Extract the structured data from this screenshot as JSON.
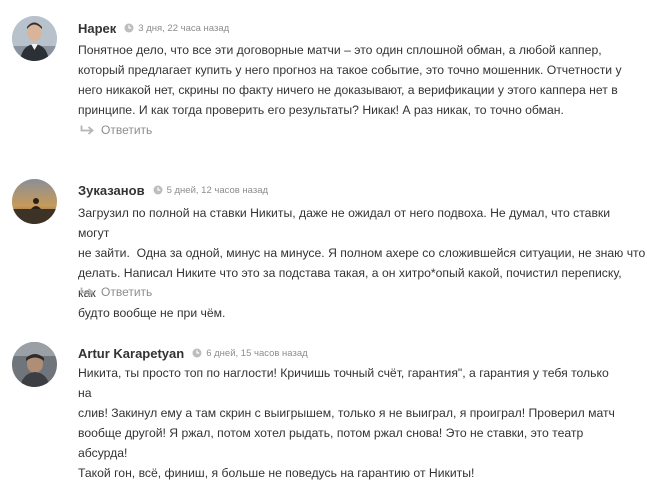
{
  "comments": [
    {
      "author": "Нарек",
      "date": "3 дня, 22 часа назад",
      "lines": [
        "Понятное дело, что все эти договорные матчи – это один сплошной обман, а любой каппер,",
        "который предлагает купить у него прогноз на такое событие, это точно мошенник. Отчетности у",
        "него никакой нет, скрины по факту ничего не доказывают, а верификации у этого каппера нет в",
        "принципе. И как тогда проверить его результаты? Никак! А раз никак, то точно обман."
      ],
      "reply_label": "Ответить"
    },
    {
      "author": "Зуказанов",
      "date": "5 дней, 12 часов назад",
      "lines": [
        "Загрузил по полной на ставки Никиты, даже не ожидал от него подвоха. Не думал, что ставки могут",
        "не зайти.  Одна за одной, минус на минусе. Я полном ахере со сложившейся ситуации, не знаю что и",
        "делать. Написал Никите что это за подстава такая, а он хитро*опый какой, почистил переписку, как",
        "будто вообще не при чём."
      ],
      "reply_label": "Ответить"
    },
    {
      "author": "Artur Karapetyan",
      "date": "6 дней, 15 часов назад",
      "lines": [
        "Никита, ты просто топ по наглости! Кричишь точный счёт, гарантия\", а гарантия у тебя только на",
        "слив! Закинул ему а там скрин с выигрышем, только я не выиграл, я проиграл! Проверил матч",
        "вообще другой! Я ржал, потом хотел рыдать, потом ржал снова! Это не ставки, это театр абсурда!",
        "Такой гон, всё, финиш, я больше не поведусь на гарантию от Никиты!"
      ]
    }
  ]
}
